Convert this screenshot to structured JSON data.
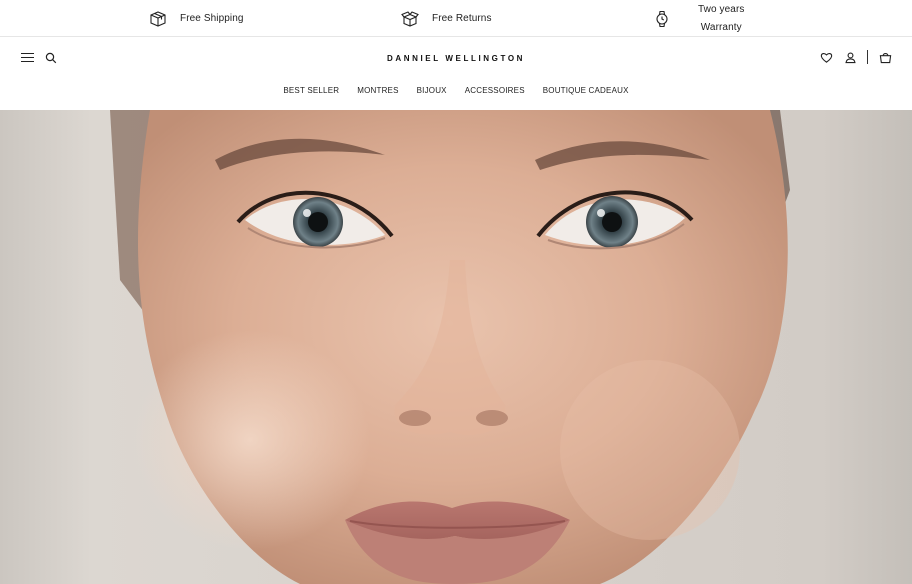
{
  "usp_bar": {
    "shipping": {
      "icon": "package-icon",
      "label": "Free Shipping"
    },
    "returns": {
      "icon": "returns-box-icon",
      "label": "Free Returns"
    },
    "warranty": {
      "icon": "watch-icon",
      "line1": "Two years",
      "line2": "Warranty"
    }
  },
  "header": {
    "logo": "DANNIEL WELLINGTON",
    "menu_icon": "hamburger-menu-icon",
    "search_icon": "search-icon",
    "wishlist_icon": "heart-icon",
    "account_icon": "user-icon",
    "cart_icon": "shopping-bag-icon"
  },
  "nav": {
    "items": [
      {
        "label": "BEST SELLER"
      },
      {
        "label": "MONTRES"
      },
      {
        "label": "BIJOUX"
      },
      {
        "label": "ACCESSOIRES"
      },
      {
        "label": "BOUTIQUE CADEAUX"
      }
    ]
  },
  "hero": {
    "image": "close-up portrait of woman's face",
    "background_color": "#d6d0ca"
  }
}
